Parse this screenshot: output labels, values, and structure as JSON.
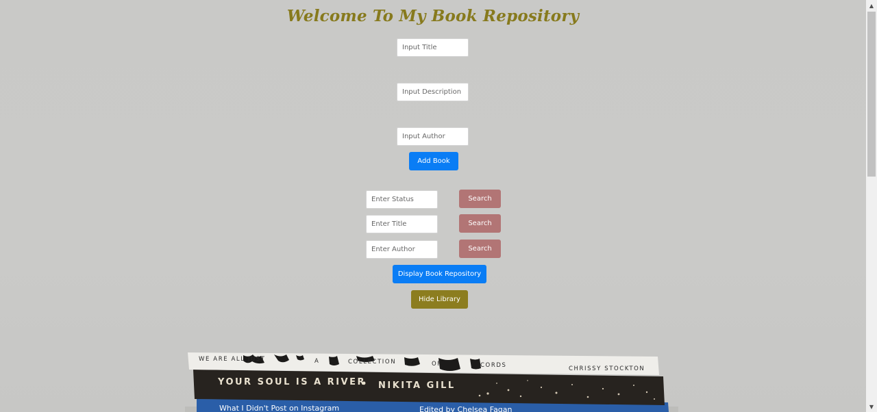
{
  "page": {
    "title": "Welcome To My Book Repository"
  },
  "add_form": {
    "title_placeholder": "Input Title",
    "description_placeholder": "Input Description",
    "author_placeholder": "Input Author",
    "add_button": "Add Book"
  },
  "search_form": {
    "status_placeholder": "Enter Status",
    "title_placeholder": "Enter Title",
    "author_placeholder": "Enter Author",
    "search_button": "Search"
  },
  "actions": {
    "display_button": "Display Book Repository",
    "hide_button": "Hide Library"
  },
  "books": {
    "spine_top": [
      "WE ARE ALL JUST",
      "A",
      "COLLECTION",
      "OF",
      "CORDS",
      "CHRISSY STOCKTON"
    ],
    "spine_middle": [
      "YOUR SOUL IS A RIVER",
      "•",
      "NIKITA GILL"
    ],
    "spine_bottom": [
      "What I Didn't Post on Instagram",
      "Edited by Chelsea Fagan"
    ]
  },
  "colors": {
    "title": "#877a1d",
    "primary_button": "#0a7df5",
    "search_button": "#b27575",
    "hide_button": "#8c7d1f"
  }
}
